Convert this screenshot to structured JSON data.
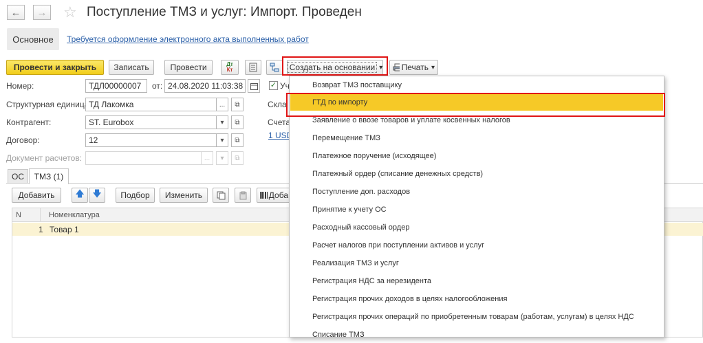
{
  "header": {
    "title": "Поступление ТМЗ и услуг: Импорт. Проведен",
    "back_icon": "←",
    "forward_icon": "→",
    "star_icon": "☆"
  },
  "top_tabs": {
    "main": "Основное",
    "link": "Требуется оформление электронного акта выполненных работ"
  },
  "toolbar": {
    "post_close": "Провести и закрыть",
    "save": "Записать",
    "post": "Провести",
    "dt_kt_top": "Дт",
    "dt_kt_bottom": "Кт",
    "create_based": "Создать на основании",
    "print": "Печать",
    "dropdown_arrow": "▾"
  },
  "form": {
    "number_label": "Номер:",
    "number_value": "ТДЛ00000007",
    "date_label": "от:",
    "date_value": "24.08.2020 11:03:38",
    "unit_label": "Структурная единица:",
    "unit_value": "ТД Лакомка",
    "counterparty_label": "Контрагент:",
    "counterparty_value": "ST. Eurobox",
    "contract_label": "Договор:",
    "contract_value": "12",
    "settlement_label": "Документ расчетов:",
    "settlement_value": "",
    "right_label_1": "Скла",
    "right_label_2": "Счета",
    "right_link": "1 USD",
    "check_label": "Уч"
  },
  "items_tabs": [
    "ОС",
    "ТМЗ (1)"
  ],
  "table_toolbar": {
    "add": "Добавить",
    "select": "Подбор",
    "change": "Изменить",
    "add_barcode": "Доба"
  },
  "table": {
    "columns": [
      "N",
      "Номенклатура"
    ],
    "rows": [
      {
        "n": "1",
        "name": "Товар 1"
      }
    ]
  },
  "dropdown_menu": {
    "items": [
      "Возврат ТМЗ поставщику",
      "ГТД по импорту",
      "Заявление о ввозе товаров и уплате косвенных налогов",
      "Перемещение ТМЗ",
      "Платежное поручение (исходящее)",
      "Платежный ордер (списание денежных средств)",
      "Поступление доп. расходов",
      "Принятие к учету ОС",
      "Расходный кассовый ордер",
      "Расчет налогов при поступлении активов и услуг",
      "Реализация ТМЗ и услуг",
      "Регистрация НДС за нерезидента",
      "Регистрация прочих доходов в целях налогообложения",
      "Регистрация прочих операций по приобретенным товарам (работам, услугам) в целях НДС",
      "Списание ТМЗ"
    ],
    "highlighted_index": 1
  },
  "colors": {
    "accent_yellow": "#f6c927",
    "highlight_red": "#e01515",
    "link_blue": "#2a5fa8"
  }
}
